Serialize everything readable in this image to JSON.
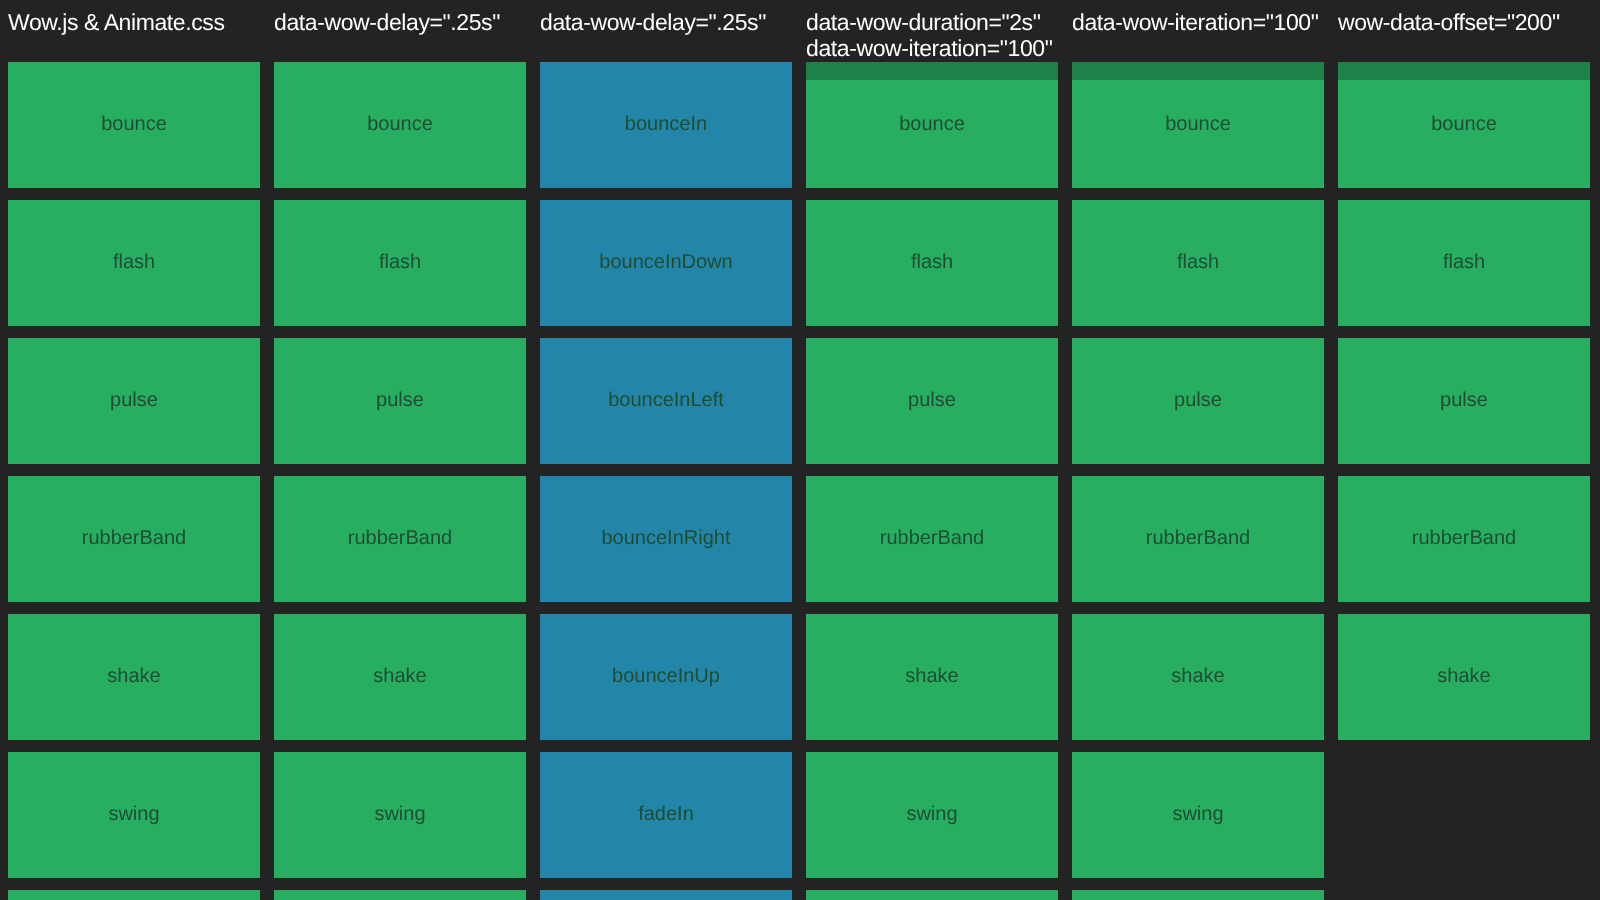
{
  "columns": [
    {
      "heading": [
        "Wow.js & Animate.css"
      ],
      "color": "#27ae60",
      "cells": [
        {
          "label": "bounce",
          "banded": false
        },
        {
          "label": "flash",
          "banded": false
        },
        {
          "label": "pulse",
          "banded": false
        },
        {
          "label": "rubberBand",
          "banded": false
        },
        {
          "label": "shake",
          "banded": false
        },
        {
          "label": "swing",
          "banded": false
        },
        {
          "banded": false
        }
      ]
    },
    {
      "heading": [
        "data-wow-delay=\".25s\""
      ],
      "color": "#27ae60",
      "cells": [
        {
          "label": "bounce",
          "banded": false
        },
        {
          "label": "flash",
          "banded": false
        },
        {
          "label": "pulse",
          "banded": false
        },
        {
          "label": "rubberBand",
          "banded": false
        },
        {
          "label": "shake",
          "banded": false
        },
        {
          "label": "swing",
          "banded": false
        },
        {
          "banded": false
        }
      ]
    },
    {
      "heading": [
        "data-wow-delay=\".25s\""
      ],
      "color": "#2386a8",
      "cells": [
        {
          "label": "bounceIn",
          "banded": false
        },
        {
          "label": "bounceInDown",
          "banded": false
        },
        {
          "label": "bounceInLeft",
          "banded": false
        },
        {
          "label": "bounceInRight",
          "banded": false
        },
        {
          "label": "bounceInUp",
          "banded": false
        },
        {
          "label": "fadeIn",
          "banded": false
        },
        {
          "banded": false
        }
      ]
    },
    {
      "heading": [
        "data-wow-duration=\"2s\"",
        "data-wow-iteration=\"100\""
      ],
      "color": "#27ae60",
      "cells": [
        {
          "label": "bounce",
          "banded": true
        },
        {
          "label": "flash",
          "banded": false
        },
        {
          "label": "pulse",
          "banded": false
        },
        {
          "label": "rubberBand",
          "banded": false
        },
        {
          "label": "shake",
          "banded": false
        },
        {
          "label": "swing",
          "banded": false
        },
        {
          "banded": false
        }
      ]
    },
    {
      "heading": [
        "data-wow-iteration=\"100\""
      ],
      "color": "#27ae60",
      "cells": [
        {
          "label": "bounce",
          "banded": true
        },
        {
          "label": "flash",
          "banded": false
        },
        {
          "label": "pulse",
          "banded": false
        },
        {
          "label": "rubberBand",
          "banded": false
        },
        {
          "label": "shake",
          "banded": false
        },
        {
          "label": "swing",
          "banded": false
        },
        {
          "banded": false
        }
      ]
    },
    {
      "heading": [
        "wow-data-offset=\"200\""
      ],
      "color": "#27ae60",
      "cells": [
        {
          "label": "bounce",
          "banded": true
        },
        {
          "label": "flash",
          "banded": false
        },
        {
          "label": "pulse",
          "banded": false
        },
        {
          "label": "rubberBand",
          "banded": false
        },
        {
          "label": "shake",
          "banded": false
        }
      ]
    }
  ]
}
